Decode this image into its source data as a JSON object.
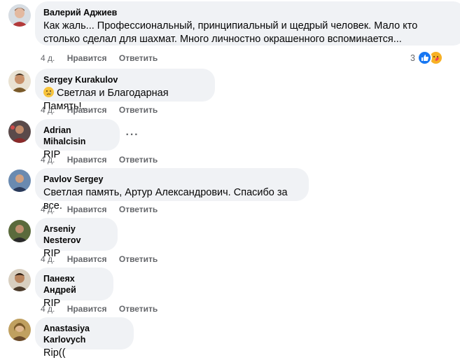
{
  "comments": [
    {
      "author": "Валерий Аджиев",
      "text_line1": "Как жаль... Профессиональный, принципиальный и щедрый человек. Мало кто",
      "text_line2": "столько сделал для шахмат. Много личностно окрашенного вспоминается...",
      "time": "4 д.",
      "like": "Нравится",
      "reply": "Ответить",
      "reaction_count": "3",
      "avatar_color": "#c9d1d9"
    },
    {
      "author": "Sergey Kurakulov",
      "text": "Светлая и Благодарная Память!..",
      "emoji": "crying-face",
      "time": "4 д.",
      "like": "Нравится",
      "reply": "Ответить",
      "avatar_color": "#b5894f"
    },
    {
      "author": "Adrian Mihalcisin",
      "text": "RIP",
      "more": "···",
      "time": "4 д.",
      "like": "Нравится",
      "reply": "Ответить",
      "avatar_color": "#7a4a3a"
    },
    {
      "author": "Pavlov Sergey",
      "text": "Светлая память, Артур Александрович. Спасибо за все.",
      "time": "4 д.",
      "like": "Нравится",
      "reply": "Ответить",
      "avatar_color": "#3c5a7a"
    },
    {
      "author": "Arseniy Nesterov",
      "text": "RIP",
      "time": "4 д.",
      "like": "Нравится",
      "reply": "Ответить",
      "avatar_color": "#4d5a3c"
    },
    {
      "author": "Панеях Андрей",
      "text": "RIP",
      "time": "4 д.",
      "like": "Нравится",
      "reply": "Ответить",
      "avatar_color": "#8a6d52"
    },
    {
      "author": "Anastasiya Karlovych",
      "text": "Rip((",
      "avatar_color": "#a88a4a"
    }
  ]
}
